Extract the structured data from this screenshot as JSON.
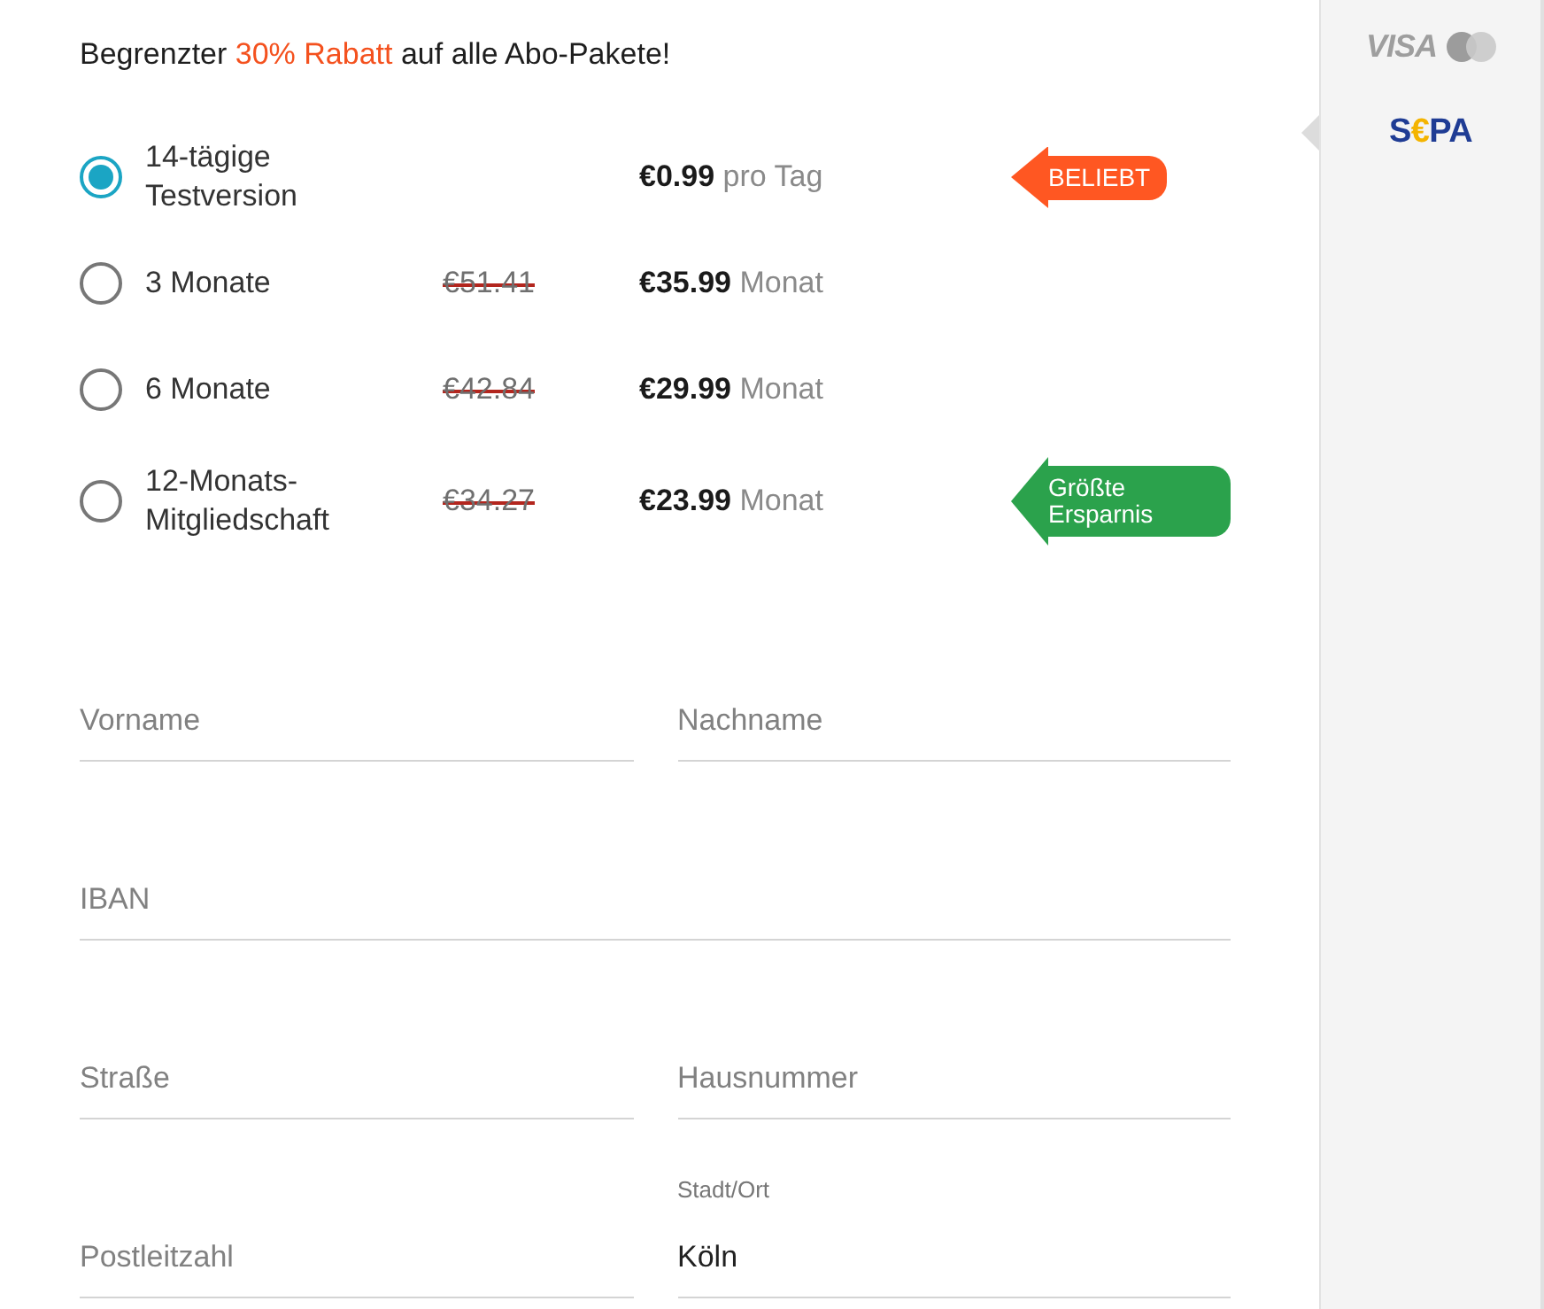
{
  "headline": [
    {
      "text": "Begrenzter ",
      "highlight": false
    },
    {
      "text": "30% Rabatt",
      "highlight": true
    },
    {
      "text": " auf alle Abo-Pakete!",
      "highlight": false
    }
  ],
  "plans": [
    {
      "name": "14-tägige Testversion",
      "selected": true,
      "price": "€0.99",
      "unit": "pro Tag",
      "tag": {
        "text": "BELIEBT",
        "color": "#ff5722"
      }
    },
    {
      "name": "3 Monate",
      "selected": false,
      "old_price": "€51.41",
      "price": "€35.99",
      "unit": "Monat"
    },
    {
      "name": "6 Monate",
      "selected": false,
      "old_price": "€42.84",
      "price": "€29.99",
      "unit": "Monat"
    },
    {
      "name": "12-Monats-Mitgliedschaft",
      "selected": false,
      "old_price": "€34.27",
      "price": "€23.99",
      "unit": "Monat",
      "tag": {
        "text": "Größte Ersparnis",
        "color": "#2ba24c"
      }
    }
  ],
  "form": {
    "rows": [
      {
        "fields": [
          {
            "placeholder": "Vorname"
          },
          {
            "placeholder": "Nachname"
          }
        ]
      },
      {
        "fields": [
          {
            "placeholder": "IBAN"
          }
        ]
      },
      {
        "fields": [
          {
            "placeholder": "Straße"
          },
          {
            "placeholder": "Hausnummer"
          }
        ]
      },
      {
        "fields": [
          {
            "placeholder": "Postleitzahl"
          },
          {
            "label": "Stadt/Ort",
            "value": "Köln"
          }
        ]
      }
    ]
  },
  "payment_methods": [
    {
      "kind": "cards",
      "label": "VISA",
      "selected": false
    },
    {
      "kind": "sepa",
      "label_parts": [
        {
          "text": "S",
          "accent": false
        },
        {
          "text": "€",
          "accent": true
        },
        {
          "text": "PA",
          "accent": false
        }
      ],
      "selected": true
    }
  ]
}
